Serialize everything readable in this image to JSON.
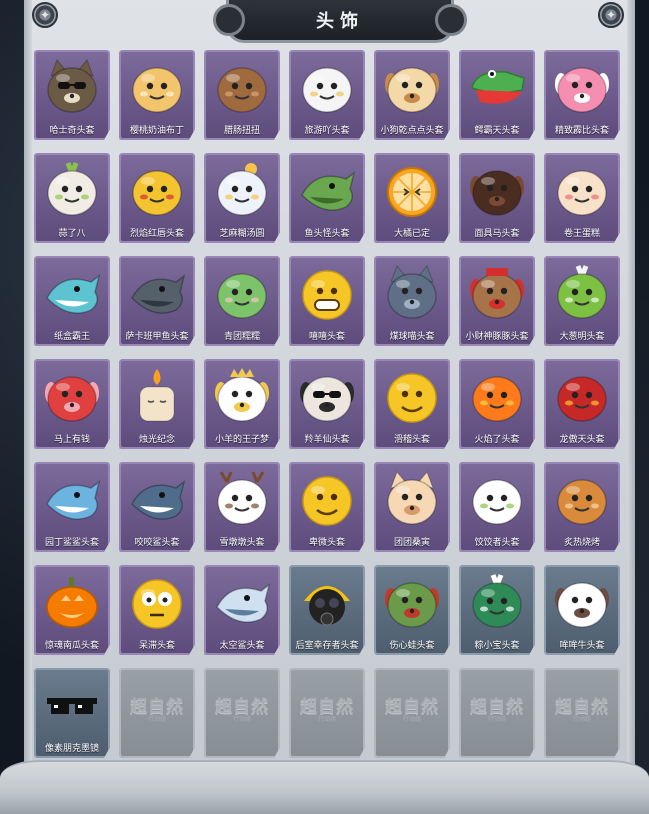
{
  "header": {
    "title": "头饰"
  },
  "lock_watermark": {
    "main": "超自然",
    "sub": "行动组"
  },
  "items": [
    {
      "name": "哈士奇头套",
      "icon": "husky-dog-head-icon",
      "rarity": "purple",
      "colors": [
        "#6b5a45",
        "#e9dcc4"
      ]
    },
    {
      "name": "樱桃奶油布丁",
      "icon": "cherry-pudding-icon",
      "rarity": "purple",
      "colors": [
        "#f2c46b",
        "#fff3e0"
      ]
    },
    {
      "name": "腊肠扭扭",
      "icon": "dachshund-head-icon",
      "rarity": "purple",
      "colors": [
        "#a06a3f",
        "#d9a877"
      ]
    },
    {
      "name": "旅游吖头套",
      "icon": "tourist-duck-hat-icon",
      "rarity": "purple",
      "colors": [
        "#f5f5f5",
        "#e9c65a"
      ]
    },
    {
      "name": "小狗乾点点头套",
      "icon": "spotted-puppy-icon",
      "rarity": "purple",
      "colors": [
        "#f3d9a8",
        "#c98a4b"
      ]
    },
    {
      "name": "鳄霸天头套",
      "icon": "crocodile-head-icon",
      "rarity": "purple",
      "colors": [
        "#4caf50",
        "#e53935"
      ]
    },
    {
      "name": "精致霹比头套",
      "icon": "pink-piggy-glasses-icon",
      "rarity": "purple",
      "colors": [
        "#f48fb1",
        "#ffffff"
      ]
    },
    {
      "name": "蒜了八",
      "icon": "garlic-head-icon",
      "rarity": "purple",
      "colors": [
        "#f1ede4",
        "#8bc34a"
      ]
    },
    {
      "name": "烈焰红唇头套",
      "icon": "yellow-pikachu-lips-icon",
      "rarity": "purple",
      "colors": [
        "#f4c430",
        "#d32f2f"
      ]
    },
    {
      "name": "芝麻糊汤圆",
      "icon": "tangyuan-flower-icon",
      "rarity": "purple",
      "colors": [
        "#eef3fb",
        "#f6c24a"
      ]
    },
    {
      "name": "鱼头怪头套",
      "icon": "green-fish-head-icon",
      "rarity": "purple",
      "colors": [
        "#6aa84f",
        "#3d6b2a"
      ]
    },
    {
      "name": "大橘已定",
      "icon": "orange-slice-face-icon",
      "rarity": "purple",
      "colors": [
        "#f6a623",
        "#ffe0a3"
      ]
    },
    {
      "name": "面具马头套",
      "icon": "horse-mask-icon",
      "rarity": "purple",
      "colors": [
        "#4a2d20",
        "#7a4a34"
      ]
    },
    {
      "name": "卷王蛋糕",
      "icon": "swiss-roll-cake-icon",
      "rarity": "purple",
      "colors": [
        "#f7e1c8",
        "#e57373"
      ]
    },
    {
      "name": "纸盒霸王",
      "icon": "cardboard-shark-icon",
      "rarity": "purple",
      "colors": [
        "#5ec3d0",
        "#ffffff"
      ]
    },
    {
      "name": "萨卡班甲鱼头套",
      "icon": "grey-fish-head-icon",
      "rarity": "purple",
      "colors": [
        "#55606b",
        "#2f3740"
      ]
    },
    {
      "name": "青团糯糯",
      "icon": "green-rice-ball-icon",
      "rarity": "purple",
      "colors": [
        "#7cc36a",
        "#f8c5c5"
      ]
    },
    {
      "name": "嘻嘻头套",
      "icon": "grin-emoji-icon",
      "rarity": "purple",
      "colors": [
        "#f6c627",
        "#5a3b00"
      ]
    },
    {
      "name": "煤球喵头套",
      "icon": "grey-cat-head-icon",
      "rarity": "purple",
      "colors": [
        "#5f6f85",
        "#9fb0c4"
      ]
    },
    {
      "name": "小财神豚豚头套",
      "icon": "capybara-god-of-wealth-icon",
      "rarity": "purple",
      "colors": [
        "#a7744a",
        "#d32f2f"
      ]
    },
    {
      "name": "大葱明头套",
      "icon": "green-onion-head-icon",
      "rarity": "purple",
      "colors": [
        "#7cc142",
        "#f5f5f5"
      ]
    },
    {
      "name": "马上有钱",
      "icon": "red-horse-coin-icon",
      "rarity": "purple",
      "colors": [
        "#e0403f",
        "#f4a6b2"
      ]
    },
    {
      "name": "烛光纪念",
      "icon": "candle-head-icon",
      "rarity": "purple",
      "colors": [
        "#f3e3c9",
        "#ff9f1c"
      ]
    },
    {
      "name": "小羊的王子梦",
      "icon": "sheep-prince-crown-icon",
      "rarity": "purple",
      "colors": [
        "#ffffff",
        "#f2c94c"
      ]
    },
    {
      "name": "羚羊仙头套",
      "icon": "sunglasses-bear-icon",
      "rarity": "purple",
      "colors": [
        "#ece6df",
        "#2b2b2b"
      ]
    },
    {
      "name": "滑稽头套",
      "icon": "funny-smirk-emoji-icon",
      "rarity": "purple",
      "colors": [
        "#f6c627",
        "#8a5a00"
      ]
    },
    {
      "name": "火焰了头套",
      "icon": "fire-spirit-icon",
      "rarity": "purple",
      "colors": [
        "#ff7a1a",
        "#ffd24a"
      ]
    },
    {
      "name": "龙傲天头套",
      "icon": "dragon-dance-head-icon",
      "rarity": "purple",
      "colors": [
        "#c62828",
        "#fbc02d"
      ]
    },
    {
      "name": "园丁鲨鲨头套",
      "icon": "blue-shark-hood-icon",
      "rarity": "purple",
      "colors": [
        "#6db3e0",
        "#ffffff"
      ]
    },
    {
      "name": "咬咬鲨头套",
      "icon": "shark-jaws-icon",
      "rarity": "purple",
      "colors": [
        "#4f6d8a",
        "#ffffff"
      ]
    },
    {
      "name": "雪墩墩头套",
      "icon": "snowman-antler-icon",
      "rarity": "purple",
      "colors": [
        "#ffffff",
        "#7a4a2a"
      ]
    },
    {
      "name": "卑微头套",
      "icon": "shy-emoji-icon",
      "rarity": "purple",
      "colors": [
        "#f6c627",
        "#6b4400"
      ]
    },
    {
      "name": "团团桑寅",
      "icon": "cream-cat-head-icon",
      "rarity": "purple",
      "colors": [
        "#f6d8b5",
        "#d99a6c"
      ]
    },
    {
      "name": "饺饺者头套",
      "icon": "dumpling-cloud-icon",
      "rarity": "purple",
      "colors": [
        "#ffffff",
        "#8bc34a"
      ]
    },
    {
      "name": "炙热烧烤",
      "icon": "grilled-meat-icon",
      "rarity": "purple",
      "colors": [
        "#d98a3a",
        "#f4d7a8"
      ]
    },
    {
      "name": "惊魂南瓜头套",
      "icon": "pumpkin-lantern-icon",
      "rarity": "purple",
      "colors": [
        "#f57c00",
        "#ffcc80"
      ]
    },
    {
      "name": "呆滞头套",
      "icon": "stunned-emoji-icon",
      "rarity": "purple",
      "colors": [
        "#f6c627",
        "#3b2a00"
      ]
    },
    {
      "name": "太空鲨头套",
      "icon": "space-shark-icon",
      "rarity": "purple",
      "colors": [
        "#cfe0f0",
        "#5a7da0"
      ]
    },
    {
      "name": "后室幸存者头套",
      "icon": "gas-mask-helmet-icon",
      "rarity": "blue",
      "colors": [
        "#f4c20d",
        "#222222"
      ]
    },
    {
      "name": "伤心蛙头套",
      "icon": "sad-frog-icon",
      "rarity": "blue",
      "colors": [
        "#6a9a4a",
        "#c0392b"
      ]
    },
    {
      "name": "粽小宝头套",
      "icon": "zongzi-leaf-icon",
      "rarity": "blue",
      "colors": [
        "#2e8b57",
        "#ffffff"
      ]
    },
    {
      "name": "哞哞牛头套",
      "icon": "cow-head-icon",
      "rarity": "blue",
      "colors": [
        "#ffffff",
        "#6d4c41"
      ]
    },
    {
      "name": "像素朋克墨镜",
      "icon": "pixel-sunglasses-icon",
      "rarity": "blue",
      "colors": [
        "#111111",
        "#ffffff"
      ]
    }
  ],
  "locked_slots": 6
}
